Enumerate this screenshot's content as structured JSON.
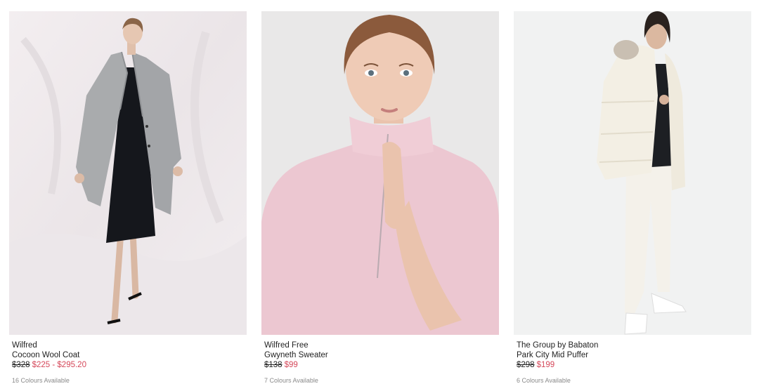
{
  "products": [
    {
      "brand": "Wilfred",
      "name": "Cocoon Wool Coat",
      "original_price": "$328",
      "sale_price": "$225 - $295.20",
      "colours": "16 Colours Available",
      "image": "woman-grey-wool-coat-photo"
    },
    {
      "brand": "Wilfred Free",
      "name": "Gwyneth Sweater",
      "original_price": "$138",
      "sale_price": "$99",
      "colours": "7 Colours Available",
      "image": "woman-pink-sweater-photo"
    },
    {
      "brand": "The Group by Babaton",
      "name": "Park City Mid Puffer",
      "original_price": "$298",
      "sale_price": "$199",
      "colours": "6 Colours Available",
      "image": "woman-white-puffer-photo"
    }
  ],
  "colors": {
    "sale": "#d5485a",
    "text": "#222222",
    "muted": "#8a8a8a",
    "grey_coat": "#a9abad",
    "pink_sweater": "#ecc7d1",
    "cream_puffer": "#f3efe4"
  }
}
